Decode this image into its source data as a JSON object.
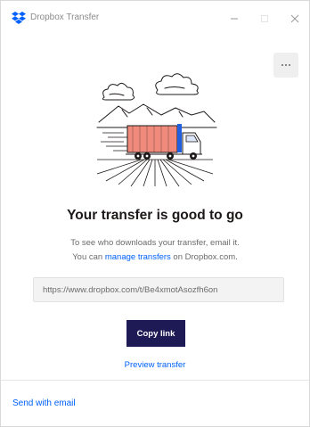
{
  "window": {
    "title": "Dropbox Transfer"
  },
  "main": {
    "heading": "Your transfer is good to go",
    "description_line1": "To see who downloads your transfer, email it.",
    "description_line2_prefix": "You can ",
    "manage_link": "manage transfers",
    "description_line2_suffix": " on Dropbox.com.",
    "url_value": "https://www.dropbox.com/t/Be4xmotAsozfh6on",
    "copy_label": "Copy link",
    "preview_label": "Preview transfer"
  },
  "footer": {
    "send_email_label": "Send with email"
  },
  "colors": {
    "accent": "#0061fe",
    "button": "#1e1a55",
    "truck_red": "#f08a7c",
    "truck_blue": "#1f5fe0"
  },
  "icons": {
    "logo": "dropbox-logo-icon",
    "minimize": "minimize-icon",
    "maximize": "maximize-icon",
    "close": "close-icon",
    "more": "more-options-icon"
  }
}
